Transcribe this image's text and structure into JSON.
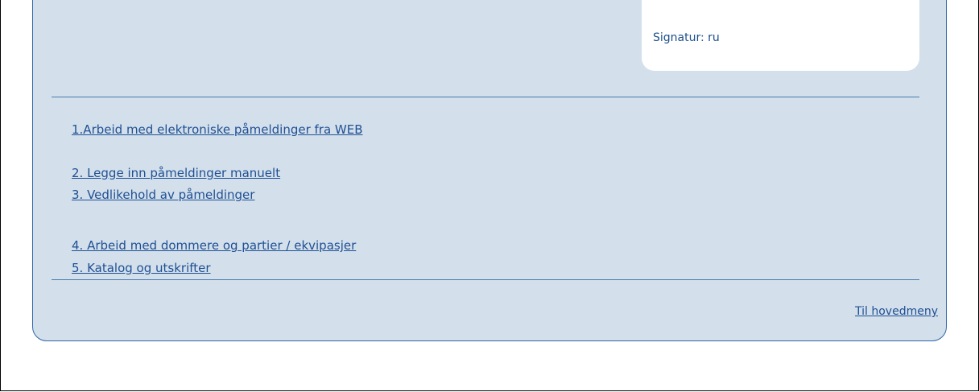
{
  "signature": {
    "text": "Signatur: ru"
  },
  "menu": {
    "items": [
      {
        "label": "1.Arbeid med elektroniske påmeldinger fra WEB"
      },
      {
        "label": "2. Legge inn påmeldinger manuelt"
      },
      {
        "label": "3. Vedlikehold av påmeldinger"
      },
      {
        "label": "4. Arbeid med dommere og partier / ekvipasjer"
      },
      {
        "label": "5. Katalog og utskrifter"
      }
    ]
  },
  "footer": {
    "home_link": "Til hovedmeny"
  }
}
